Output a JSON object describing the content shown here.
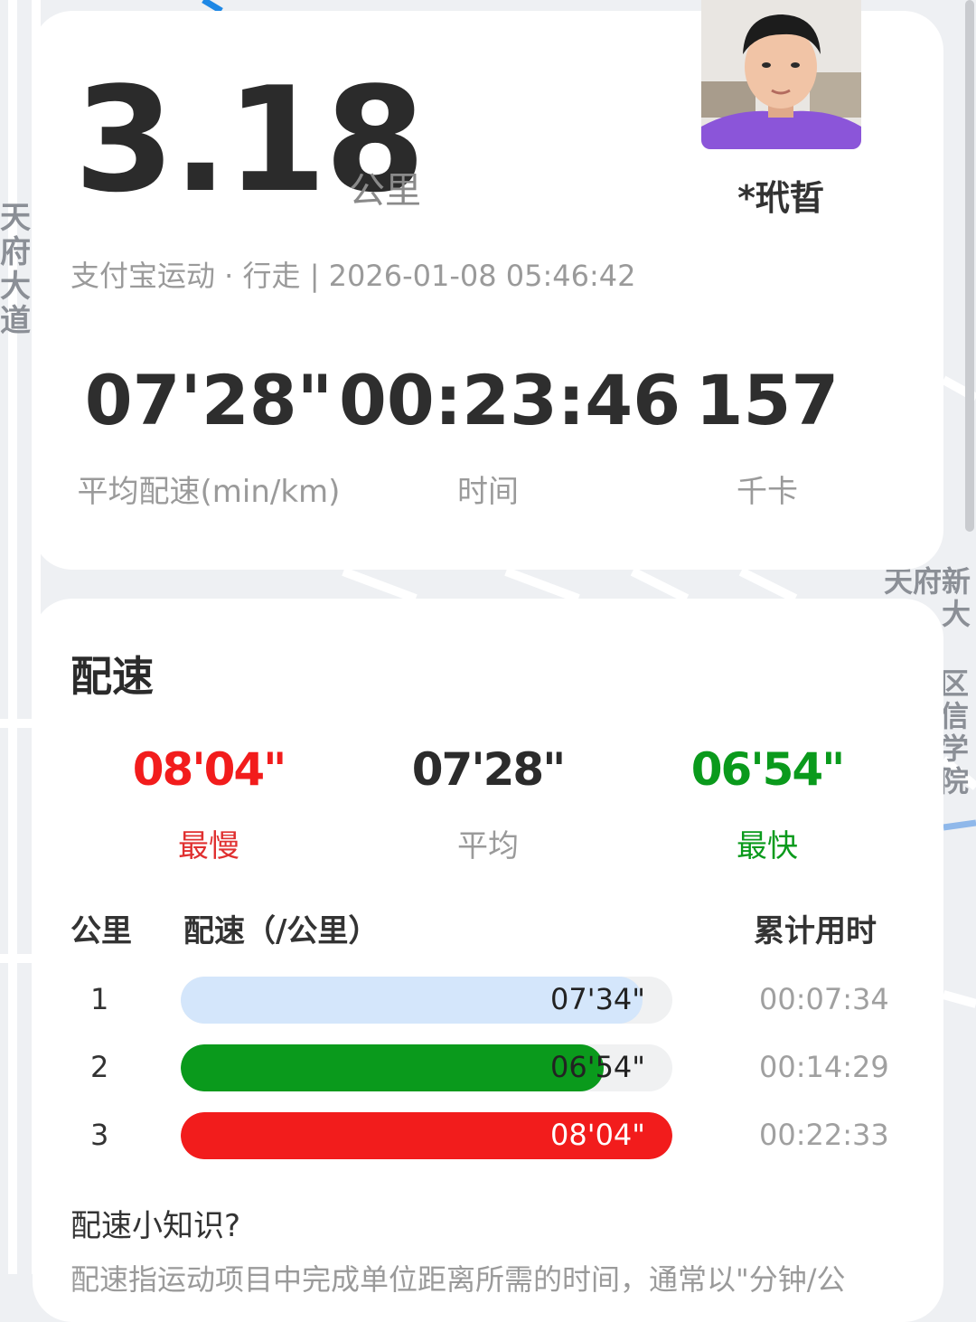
{
  "map": {
    "label_vertical": "天府大道",
    "label_right_1": "天府新大",
    "label_right_2": "区信学院"
  },
  "summary": {
    "distance": "3.18",
    "distance_unit": "公里",
    "username": "*玳晢",
    "meta": "支付宝运动 · 行走 | 2026-01-08 05:46:42",
    "stats": [
      {
        "value": "07'28\"",
        "label": "平均配速(min/km)"
      },
      {
        "value": "00:23:46",
        "label": "时间"
      },
      {
        "value": "157",
        "label": "千卡"
      }
    ]
  },
  "pace": {
    "title": "配速",
    "slowest": {
      "value": "08'04\"",
      "label": "最慢"
    },
    "average": {
      "value": "07'28\"",
      "label": "平均"
    },
    "fastest": {
      "value": "06'54\"",
      "label": "最快"
    },
    "colors": {
      "slow": "#f21c1c",
      "fast": "#0a9a1c",
      "normal": "#d4e6fb"
    },
    "headers": {
      "km": "公里",
      "pace": "配速（/公里）",
      "cumulative": "累计用时"
    },
    "rows": [
      {
        "km": "1",
        "pace": "07'34\"",
        "cumulative": "00:07:34",
        "fill": 0.94,
        "type": "normal"
      },
      {
        "km": "2",
        "pace": "06'54\"",
        "cumulative": "00:14:29",
        "fill": 0.86,
        "type": "fast"
      },
      {
        "km": "3",
        "pace": "08'04\"",
        "cumulative": "00:22:33",
        "fill": 1.0,
        "type": "slow"
      }
    ],
    "tip_title": "配速小知识?",
    "tip_text": "配速指运动项目中完成单位距离所需的时间，通常以\"分钟/公"
  }
}
